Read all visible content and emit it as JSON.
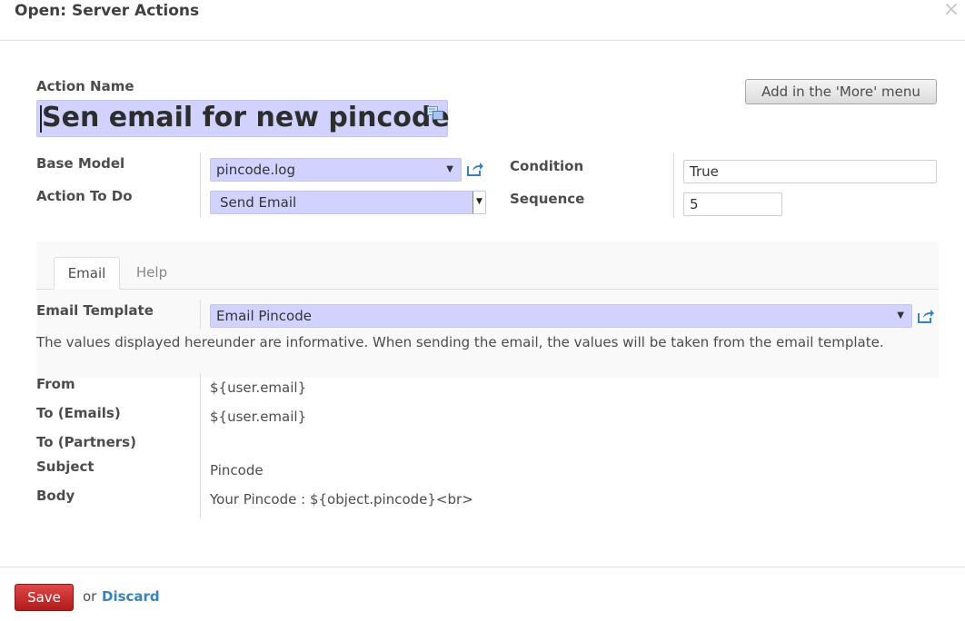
{
  "dialog": {
    "title": "Open: Server Actions",
    "close_glyph": "×"
  },
  "action_name": {
    "label": "Action Name",
    "value": "Sen email for new pincode"
  },
  "more_menu_button": "Add in the 'More' menu",
  "base_model": {
    "label": "Base Model",
    "value": "pincode.log"
  },
  "action_to_do": {
    "label": "Action To Do",
    "value": "Send Email"
  },
  "condition": {
    "label": "Condition",
    "value": "True"
  },
  "sequence": {
    "label": "Sequence",
    "value": "5"
  },
  "tabs": [
    {
      "label": "Email",
      "active": true
    },
    {
      "label": "Help",
      "active": false
    }
  ],
  "email_template": {
    "label": "Email Template",
    "value": "Email Pincode"
  },
  "info_text": "The values displayed hereunder are informative. When sending the email, the values will be taken from the email template.",
  "fields": {
    "from": {
      "label": "From",
      "value": "${user.email}"
    },
    "to_emails": {
      "label": "To (Emails)",
      "value": "${user.email}"
    },
    "to_partners": {
      "label": "To (Partners)",
      "value": ""
    },
    "subject": {
      "label": "Subject",
      "value": "Pincode"
    },
    "body": {
      "label": "Body",
      "value": "Your Pincode : ${object.pincode}<br>"
    }
  },
  "footer": {
    "save": "Save",
    "or": "or",
    "discard": "Discard"
  },
  "colors": {
    "required_field_bg": "#d2d2ff",
    "save_button": "#c82828",
    "link": "#3a83b8"
  }
}
